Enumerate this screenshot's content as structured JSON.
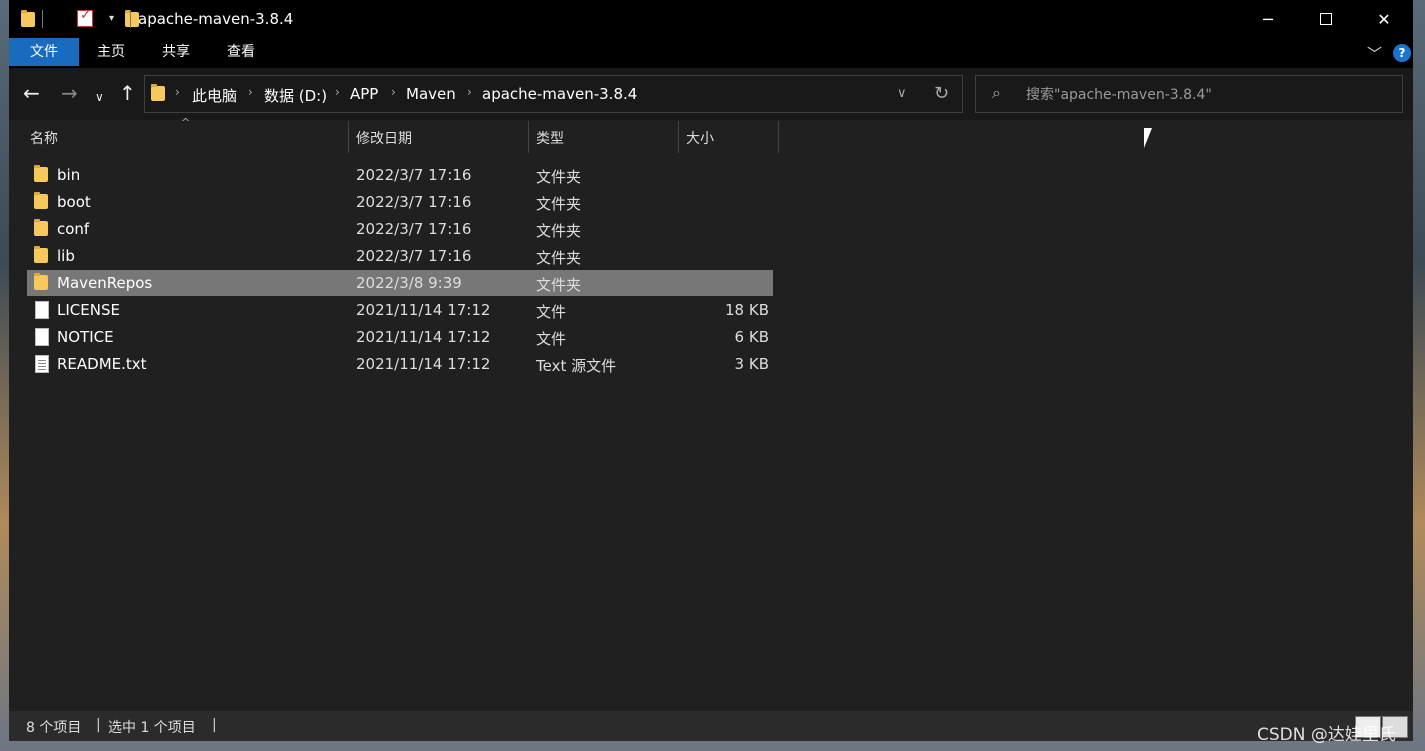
{
  "window": {
    "title": "apache-maven-3.8.4",
    "minimize_icon": "minimize-icon",
    "maximize_icon": "maximize-icon",
    "close_icon": "close-icon"
  },
  "ribbon": {
    "tabs": [
      "文件",
      "主页",
      "共享",
      "查看"
    ],
    "help": "?"
  },
  "nav": {
    "breadcrumbs": [
      "此电脑",
      "数据 (D:)",
      "APP",
      "Maven",
      "apache-maven-3.8.4"
    ],
    "search_placeholder": "搜索\"apache-maven-3.8.4\""
  },
  "columns": [
    "名称",
    "修改日期",
    "类型",
    "大小"
  ],
  "files": [
    {
      "name": "bin",
      "date": "2022/3/7 17:16",
      "type": "文件夹",
      "size": "",
      "icon": "folder-icon"
    },
    {
      "name": "boot",
      "date": "2022/3/7 17:16",
      "type": "文件夹",
      "size": "",
      "icon": "folder-icon"
    },
    {
      "name": "conf",
      "date": "2022/3/7 17:16",
      "type": "文件夹",
      "size": "",
      "icon": "folder-icon"
    },
    {
      "name": "lib",
      "date": "2022/3/7 17:16",
      "type": "文件夹",
      "size": "",
      "icon": "folder-icon"
    },
    {
      "name": "MavenRepos",
      "date": "2022/3/8 9:39",
      "type": "文件夹",
      "size": "",
      "icon": "folder-icon",
      "selected": true
    },
    {
      "name": "LICENSE",
      "date": "2021/11/14 17:12",
      "type": "文件",
      "size": "18 KB",
      "icon": "file-icon"
    },
    {
      "name": "NOTICE",
      "date": "2021/11/14 17:12",
      "type": "文件",
      "size": "6 KB",
      "icon": "file-icon"
    },
    {
      "name": "README.txt",
      "date": "2021/11/14 17:12",
      "type": "Text 源文件",
      "size": "3 KB",
      "icon": "text-file-icon"
    }
  ],
  "status": {
    "item_count": "8 个项目",
    "selected_count": "选中 1 个项目"
  },
  "watermark": "CSDN @达娃里氏"
}
